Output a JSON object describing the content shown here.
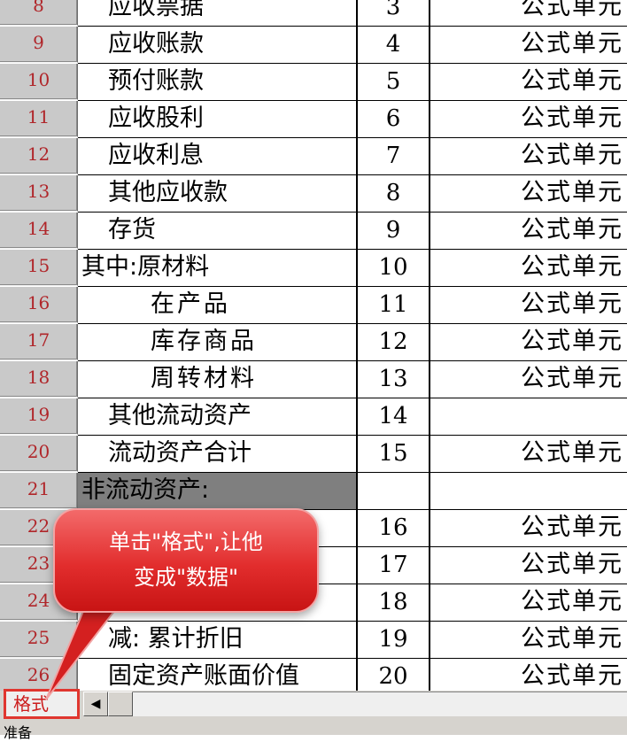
{
  "rows": [
    {
      "num": "8",
      "name": "应收票据",
      "line": "3",
      "formula": "公式单元",
      "indent": 1
    },
    {
      "num": "9",
      "name": "应收账款",
      "line": "4",
      "formula": "公式单元",
      "indent": 1
    },
    {
      "num": "10",
      "name": "预付账款",
      "line": "5",
      "formula": "公式单元",
      "indent": 1
    },
    {
      "num": "11",
      "name": "应收股利",
      "line": "6",
      "formula": "公式单元",
      "indent": 1
    },
    {
      "num": "12",
      "name": "应收利息",
      "line": "7",
      "formula": "公式单元",
      "indent": 1
    },
    {
      "num": "13",
      "name": "其他应收款",
      "line": "8",
      "formula": "公式单元",
      "indent": 1
    },
    {
      "num": "14",
      "name": "存货",
      "line": "9",
      "formula": "公式单元",
      "indent": 1
    },
    {
      "num": "15",
      "name": "其中:原材料",
      "line": "10",
      "formula": "公式单元",
      "indent": 0
    },
    {
      "num": "16",
      "name": "在产品",
      "line": "11",
      "formula": "公式单元",
      "indent": 2
    },
    {
      "num": "17",
      "name": "库存商品",
      "line": "12",
      "formula": "公式单元",
      "indent": 2
    },
    {
      "num": "18",
      "name": "周转材料",
      "line": "13",
      "formula": "公式单元",
      "indent": 2
    },
    {
      "num": "19",
      "name": "其他流动资产",
      "line": "14",
      "formula": "",
      "indent": 1
    },
    {
      "num": "20",
      "name": "流动资产合计",
      "line": "15",
      "formula": "公式单元",
      "indent": 1
    },
    {
      "num": "21",
      "name": "非流动资产:",
      "line": "",
      "formula": "",
      "indent": 0,
      "highlight": true
    },
    {
      "num": "22",
      "name": "",
      "line": "16",
      "formula": "公式单元",
      "indent": 1
    },
    {
      "num": "23",
      "name": "",
      "line": "17",
      "formula": "公式单元",
      "indent": 1
    },
    {
      "num": "24",
      "name": "",
      "line": "18",
      "formula": "公式单元",
      "indent": 1
    },
    {
      "num": "25",
      "name": "减: 累计折旧",
      "line": "19",
      "formula": "公式单元",
      "indent": 1
    },
    {
      "num": "26",
      "name": "固定资产账面价值",
      "line": "20",
      "formula": "公式单元",
      "indent": 1
    }
  ],
  "mode_tab": {
    "label": "格式"
  },
  "scroll": {
    "left_icon": "scroll-left-icon",
    "right_icon": "scroll-right-icon"
  },
  "status": {
    "text": "准备"
  },
  "callout": {
    "line1": "单击\"格式\",让他",
    "line2": "变成\"数据\""
  },
  "colors": {
    "row_header_text": "#b0262a",
    "callout_fill": "#e22d2d",
    "tab_border": "#e0362f"
  }
}
